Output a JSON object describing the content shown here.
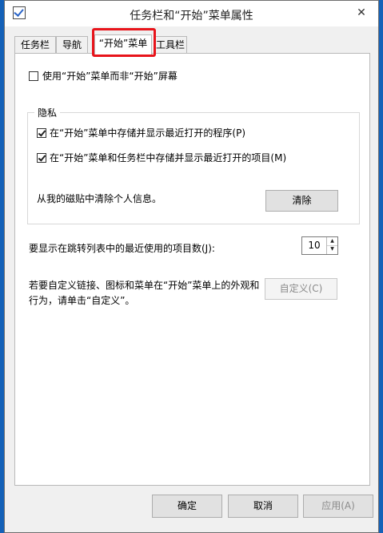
{
  "window": {
    "title": "任务栏和“开始”菜单属性",
    "close_glyph": "✕",
    "app_icon": "checkbox-app-icon"
  },
  "tabs": [
    {
      "label": "任务栏"
    },
    {
      "label": "导航"
    },
    {
      "label": "“开始”菜单",
      "active": true,
      "highlighted": true
    },
    {
      "label": "工具栏"
    }
  ],
  "start_menu": {
    "use_start_screen_label": "使用“开始”菜单而非“开始”屏幕",
    "use_start_screen_checked": false
  },
  "privacy": {
    "group_title": "隐私",
    "store_programs_label": "在“开始”菜单中存储并显示最近打开的程序(P)",
    "store_programs_checked": true,
    "store_items_label": "在“开始”菜单和任务栏中存储并显示最近打开的项目(M)",
    "store_items_checked": true,
    "clear_tiles_label": "从我的磁贴中清除个人信息。",
    "clear_button": "清除"
  },
  "jump_list": {
    "label": "要显示在跳转列表中的最近使用的项目数(J):",
    "value": "10"
  },
  "customize": {
    "text_line1": "若要自定义链接、图标和菜单在“开始”菜单上的外观和",
    "text_line2": "行为，请单击“自定义”。",
    "button": "自定义(C)"
  },
  "footer": {
    "ok": "确定",
    "cancel": "取消",
    "apply": "应用(A)"
  },
  "colors": {
    "highlight": "#e8141b",
    "desktop": "#1d6cc4"
  }
}
